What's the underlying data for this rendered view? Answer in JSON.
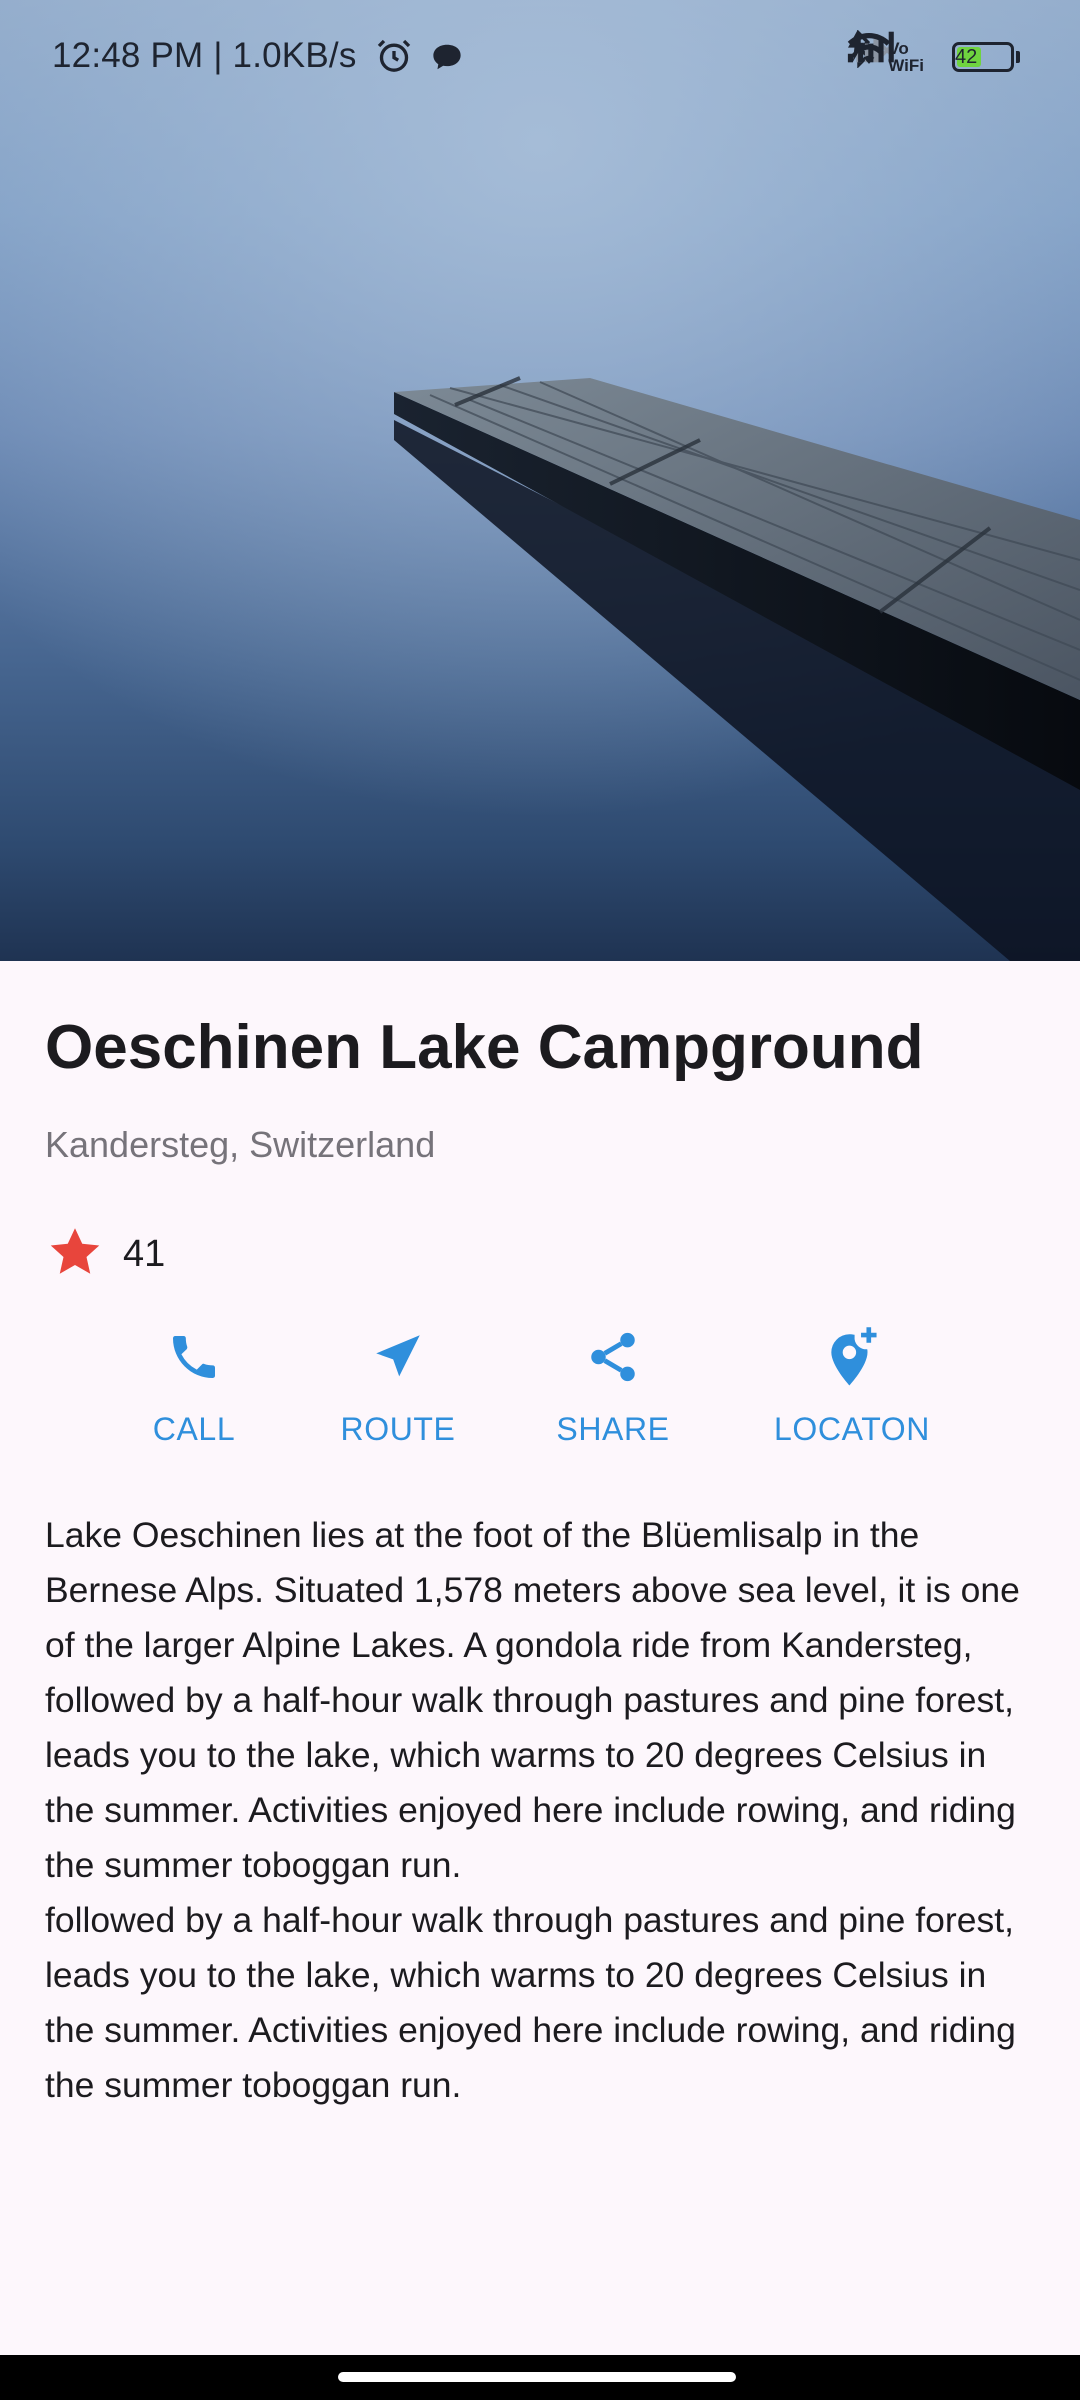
{
  "status_bar": {
    "time_speed": "12:48 PM | 1.0KB/s",
    "vowifi_top": "Vo",
    "vowifi_bottom": "WiFi",
    "battery_level": "42",
    "battery_fraction": 0.42,
    "icons": [
      "alarm-icon",
      "chat-bubble-icon",
      "bluetooth-icon",
      "no-signal-icon",
      "signal-icon",
      "vowifi-icon",
      "wifi-icon",
      "battery-icon",
      "charging-icon"
    ]
  },
  "hero": {
    "alt": "",
    "colors": {
      "sky_top": "#8fa9c9",
      "water_bottom": "#1f3352",
      "dock": "#6e7b88"
    }
  },
  "place": {
    "title": "Oeschinen Lake Campground",
    "location": "Kandersteg, Switzerland",
    "rating_count": "41",
    "rating_icon": "star-icon",
    "star_color": "#e8453c"
  },
  "actions": [
    {
      "label": "CALL",
      "icon": "phone-icon"
    },
    {
      "label": "ROUTE",
      "icon": "navigation-arrow-icon"
    },
    {
      "label": "SHARE",
      "icon": "share-icon"
    },
    {
      "label": "LOCATON",
      "icon": "add-location-icon"
    }
  ],
  "accent_color": "#2f8fdc",
  "description": {
    "paragraph_1": "Lake Oeschinen lies at the foot of the Blüemlisalp in the Bernese Alps. Situated 1,578 meters above sea level, it is one of the larger Alpine Lakes. A gondola ride from Kandersteg, followed by a half-hour walk through pastures and pine forest, leads you to the lake, which warms to 20 degrees Celsius in the summer. Activities enjoyed here include rowing, and riding the summer toboggan run.",
    "paragraph_2": "followed by a half-hour walk through pastures and pine forest, leads you to the lake, which warms to 20 degrees Celsius in the summer. Activities enjoyed here include rowing, and riding the summer toboggan run."
  }
}
